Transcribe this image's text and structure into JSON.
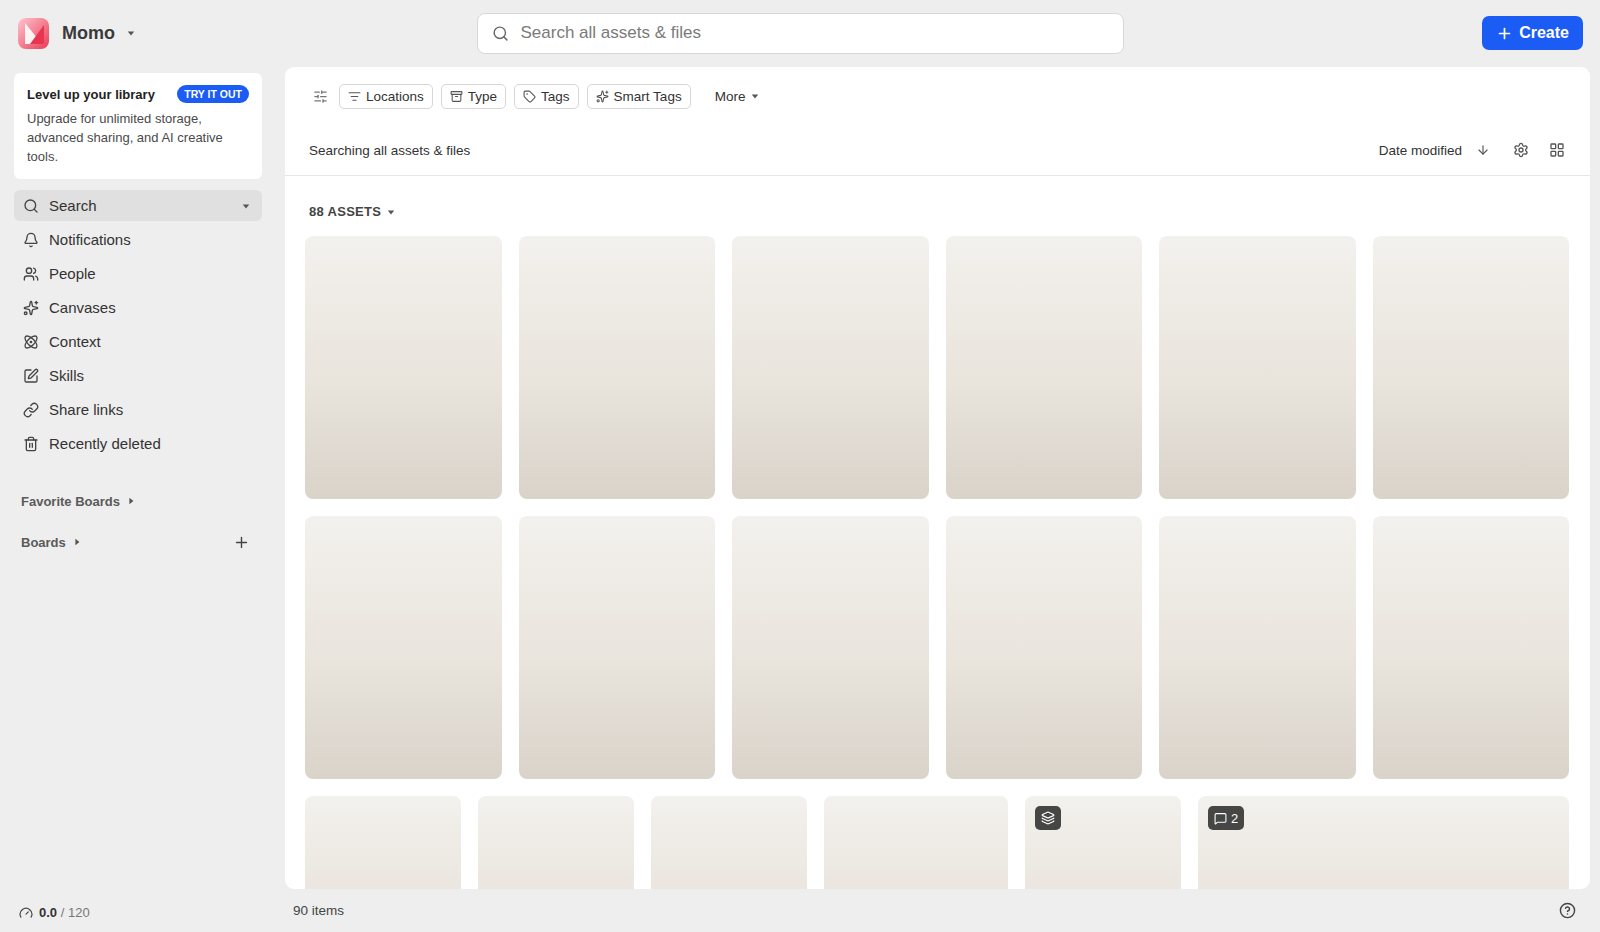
{
  "workspace": {
    "name": "Momo"
  },
  "search": {
    "placeholder": "Search all assets & files"
  },
  "create_button": {
    "label": "Create"
  },
  "promo": {
    "title": "Level up your library",
    "badge": "TRY IT OUT",
    "text": "Upgrade for unlimited storage, advanced sharing, and AI creative tools."
  },
  "sidebar": {
    "items": [
      {
        "label": "Search",
        "selected": true
      },
      {
        "label": "Notifications",
        "selected": false
      },
      {
        "label": "People",
        "selected": false
      },
      {
        "label": "Canvases",
        "selected": false
      },
      {
        "label": "Context",
        "selected": false
      },
      {
        "label": "Skills",
        "selected": false
      },
      {
        "label": "Share links",
        "selected": false
      },
      {
        "label": "Recently deleted",
        "selected": false
      }
    ],
    "sections": [
      {
        "label": "Favorite Boards",
        "expanded": false,
        "addable": false
      },
      {
        "label": "Boards",
        "expanded": false,
        "addable": true
      }
    ],
    "usage": {
      "used": "0.0",
      "limit": "/ 120"
    }
  },
  "filters": [
    "Locations",
    "Type",
    "Tags",
    "Smart Tags"
  ],
  "more_filter": "More",
  "results": {
    "scope": "Searching all assets & files",
    "sort": "Date modified",
    "count": "88 ASSETS",
    "items_total": "90 items"
  },
  "assets": {
    "rows": [
      [
        {
          "kind": "tall"
        },
        {
          "kind": "tall"
        },
        {
          "kind": "tall"
        },
        {
          "kind": "tall"
        },
        {
          "kind": "tall"
        },
        {
          "kind": "tall"
        }
      ],
      [
        {
          "kind": "tall"
        },
        {
          "kind": "tall"
        },
        {
          "kind": "tall"
        },
        {
          "kind": "tall"
        },
        {
          "kind": "tall"
        },
        {
          "kind": "tall"
        }
      ],
      [
        {
          "kind": "portrait"
        },
        {
          "kind": "portrait"
        },
        {
          "kind": "portrait"
        },
        {
          "kind": "landscape"
        },
        {
          "kind": "portrait",
          "badge": {
            "kind": "stack"
          }
        },
        {
          "kind": "wide",
          "badge": {
            "kind": "comments",
            "count": "2"
          }
        }
      ]
    ]
  }
}
